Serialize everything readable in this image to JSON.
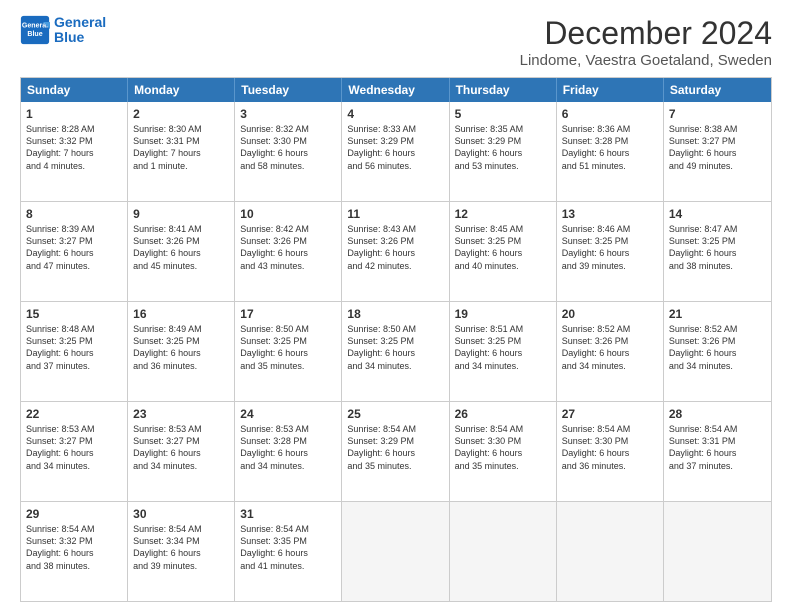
{
  "header": {
    "logo_line1": "General",
    "logo_line2": "Blue",
    "month_title": "December 2024",
    "subtitle": "Lindome, Vaestra Goetaland, Sweden"
  },
  "days_of_week": [
    "Sunday",
    "Monday",
    "Tuesday",
    "Wednesday",
    "Thursday",
    "Friday",
    "Saturday"
  ],
  "weeks": [
    [
      {
        "day": "1",
        "info": "Sunrise: 8:28 AM\nSunset: 3:32 PM\nDaylight: 7 hours\nand 4 minutes."
      },
      {
        "day": "2",
        "info": "Sunrise: 8:30 AM\nSunset: 3:31 PM\nDaylight: 7 hours\nand 1 minute."
      },
      {
        "day": "3",
        "info": "Sunrise: 8:32 AM\nSunset: 3:30 PM\nDaylight: 6 hours\nand 58 minutes."
      },
      {
        "day": "4",
        "info": "Sunrise: 8:33 AM\nSunset: 3:29 PM\nDaylight: 6 hours\nand 56 minutes."
      },
      {
        "day": "5",
        "info": "Sunrise: 8:35 AM\nSunset: 3:29 PM\nDaylight: 6 hours\nand 53 minutes."
      },
      {
        "day": "6",
        "info": "Sunrise: 8:36 AM\nSunset: 3:28 PM\nDaylight: 6 hours\nand 51 minutes."
      },
      {
        "day": "7",
        "info": "Sunrise: 8:38 AM\nSunset: 3:27 PM\nDaylight: 6 hours\nand 49 minutes."
      }
    ],
    [
      {
        "day": "8",
        "info": "Sunrise: 8:39 AM\nSunset: 3:27 PM\nDaylight: 6 hours\nand 47 minutes."
      },
      {
        "day": "9",
        "info": "Sunrise: 8:41 AM\nSunset: 3:26 PM\nDaylight: 6 hours\nand 45 minutes."
      },
      {
        "day": "10",
        "info": "Sunrise: 8:42 AM\nSunset: 3:26 PM\nDaylight: 6 hours\nand 43 minutes."
      },
      {
        "day": "11",
        "info": "Sunrise: 8:43 AM\nSunset: 3:26 PM\nDaylight: 6 hours\nand 42 minutes."
      },
      {
        "day": "12",
        "info": "Sunrise: 8:45 AM\nSunset: 3:25 PM\nDaylight: 6 hours\nand 40 minutes."
      },
      {
        "day": "13",
        "info": "Sunrise: 8:46 AM\nSunset: 3:25 PM\nDaylight: 6 hours\nand 39 minutes."
      },
      {
        "day": "14",
        "info": "Sunrise: 8:47 AM\nSunset: 3:25 PM\nDaylight: 6 hours\nand 38 minutes."
      }
    ],
    [
      {
        "day": "15",
        "info": "Sunrise: 8:48 AM\nSunset: 3:25 PM\nDaylight: 6 hours\nand 37 minutes."
      },
      {
        "day": "16",
        "info": "Sunrise: 8:49 AM\nSunset: 3:25 PM\nDaylight: 6 hours\nand 36 minutes."
      },
      {
        "day": "17",
        "info": "Sunrise: 8:50 AM\nSunset: 3:25 PM\nDaylight: 6 hours\nand 35 minutes."
      },
      {
        "day": "18",
        "info": "Sunrise: 8:50 AM\nSunset: 3:25 PM\nDaylight: 6 hours\nand 34 minutes."
      },
      {
        "day": "19",
        "info": "Sunrise: 8:51 AM\nSunset: 3:25 PM\nDaylight: 6 hours\nand 34 minutes."
      },
      {
        "day": "20",
        "info": "Sunrise: 8:52 AM\nSunset: 3:26 PM\nDaylight: 6 hours\nand 34 minutes."
      },
      {
        "day": "21",
        "info": "Sunrise: 8:52 AM\nSunset: 3:26 PM\nDaylight: 6 hours\nand 34 minutes."
      }
    ],
    [
      {
        "day": "22",
        "info": "Sunrise: 8:53 AM\nSunset: 3:27 PM\nDaylight: 6 hours\nand 34 minutes."
      },
      {
        "day": "23",
        "info": "Sunrise: 8:53 AM\nSunset: 3:27 PM\nDaylight: 6 hours\nand 34 minutes."
      },
      {
        "day": "24",
        "info": "Sunrise: 8:53 AM\nSunset: 3:28 PM\nDaylight: 6 hours\nand 34 minutes."
      },
      {
        "day": "25",
        "info": "Sunrise: 8:54 AM\nSunset: 3:29 PM\nDaylight: 6 hours\nand 35 minutes."
      },
      {
        "day": "26",
        "info": "Sunrise: 8:54 AM\nSunset: 3:30 PM\nDaylight: 6 hours\nand 35 minutes."
      },
      {
        "day": "27",
        "info": "Sunrise: 8:54 AM\nSunset: 3:30 PM\nDaylight: 6 hours\nand 36 minutes."
      },
      {
        "day": "28",
        "info": "Sunrise: 8:54 AM\nSunset: 3:31 PM\nDaylight: 6 hours\nand 37 minutes."
      }
    ],
    [
      {
        "day": "29",
        "info": "Sunrise: 8:54 AM\nSunset: 3:32 PM\nDaylight: 6 hours\nand 38 minutes."
      },
      {
        "day": "30",
        "info": "Sunrise: 8:54 AM\nSunset: 3:34 PM\nDaylight: 6 hours\nand 39 minutes."
      },
      {
        "day": "31",
        "info": "Sunrise: 8:54 AM\nSunset: 3:35 PM\nDaylight: 6 hours\nand 41 minutes."
      },
      {
        "day": "",
        "info": ""
      },
      {
        "day": "",
        "info": ""
      },
      {
        "day": "",
        "info": ""
      },
      {
        "day": "",
        "info": ""
      }
    ]
  ]
}
